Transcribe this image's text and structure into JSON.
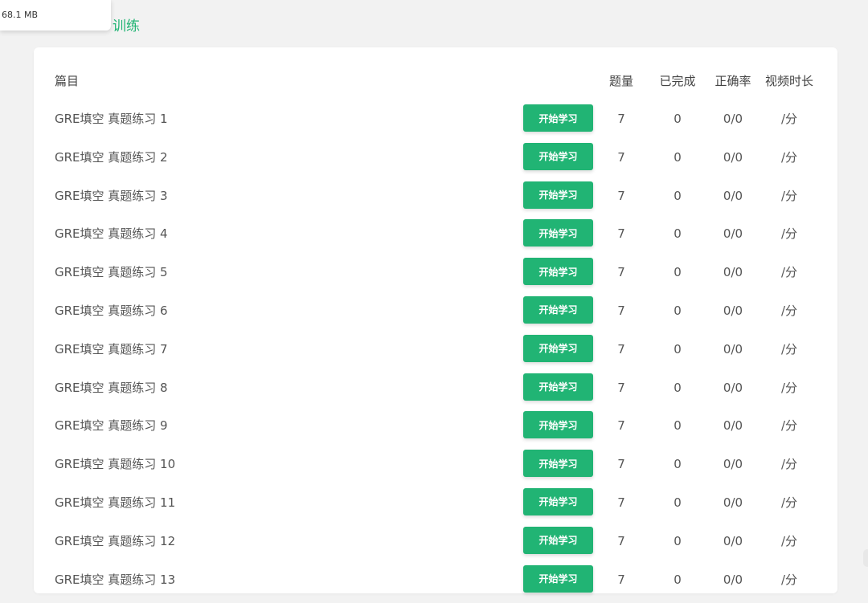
{
  "tooltip": {
    "text": "68.1 MB"
  },
  "page": {
    "heading": "训练"
  },
  "table": {
    "headers": {
      "title": "篇目",
      "count": "题量",
      "done": "已完成",
      "accuracy": "正确率",
      "video": "视频时长"
    },
    "button_label": "开始学习",
    "rows": [
      {
        "title": "GRE填空 真题练习 1",
        "count": "7",
        "done": "0",
        "accuracy": "0/0",
        "video": "/分"
      },
      {
        "title": "GRE填空 真题练习 2",
        "count": "7",
        "done": "0",
        "accuracy": "0/0",
        "video": "/分"
      },
      {
        "title": "GRE填空 真题练习 3",
        "count": "7",
        "done": "0",
        "accuracy": "0/0",
        "video": "/分"
      },
      {
        "title": "GRE填空 真题练习 4",
        "count": "7",
        "done": "0",
        "accuracy": "0/0",
        "video": "/分"
      },
      {
        "title": "GRE填空 真题练习 5",
        "count": "7",
        "done": "0",
        "accuracy": "0/0",
        "video": "/分"
      },
      {
        "title": "GRE填空 真题练习 6",
        "count": "7",
        "done": "0",
        "accuracy": "0/0",
        "video": "/分"
      },
      {
        "title": "GRE填空 真题练习 7",
        "count": "7",
        "done": "0",
        "accuracy": "0/0",
        "video": "/分"
      },
      {
        "title": "GRE填空 真题练习 8",
        "count": "7",
        "done": "0",
        "accuracy": "0/0",
        "video": "/分"
      },
      {
        "title": "GRE填空 真题练习 9",
        "count": "7",
        "done": "0",
        "accuracy": "0/0",
        "video": "/分"
      },
      {
        "title": "GRE填空 真题练习 10",
        "count": "7",
        "done": "0",
        "accuracy": "0/0",
        "video": "/分"
      },
      {
        "title": "GRE填空 真题练习 11",
        "count": "7",
        "done": "0",
        "accuracy": "0/0",
        "video": "/分"
      },
      {
        "title": "GRE填空 真题练习 12",
        "count": "7",
        "done": "0",
        "accuracy": "0/0",
        "video": "/分"
      },
      {
        "title": "GRE填空 真题练习 13",
        "count": "7",
        "done": "0",
        "accuracy": "0/0",
        "video": "/分"
      }
    ]
  },
  "colors": {
    "accent": "#21b474",
    "background": "#f2f2f2",
    "card": "#ffffff"
  }
}
